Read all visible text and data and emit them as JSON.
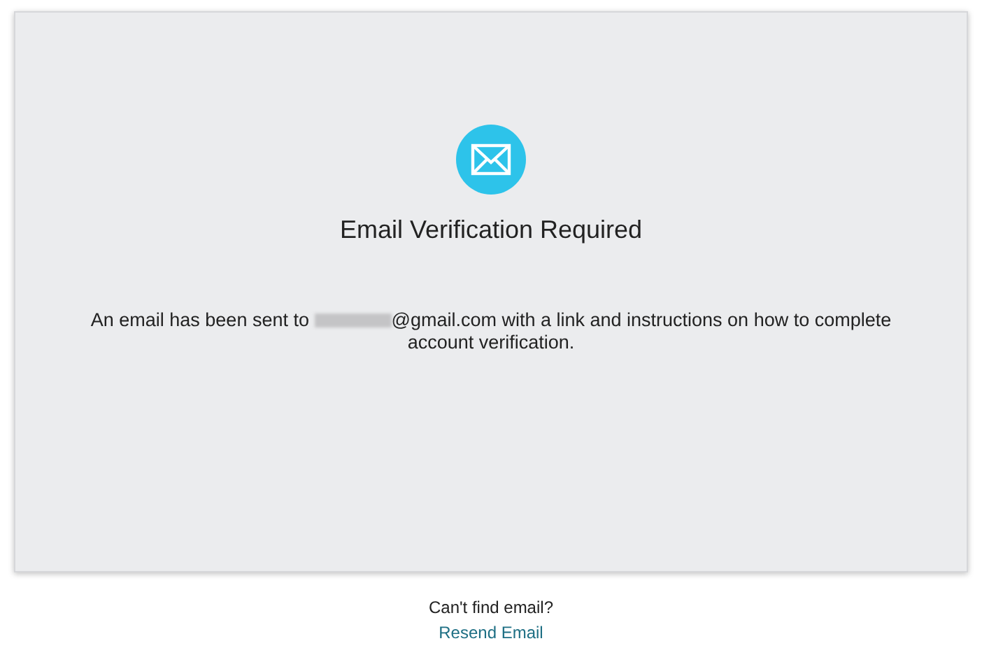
{
  "card": {
    "title": "Email Verification Required",
    "message": {
      "before": "An email has been sent to",
      "redacted": true,
      "after": "@gmail.com with a link and instructions on how to complete account verification."
    }
  },
  "footer": {
    "question": "Can't find email?",
    "link": "Resend Email"
  }
}
